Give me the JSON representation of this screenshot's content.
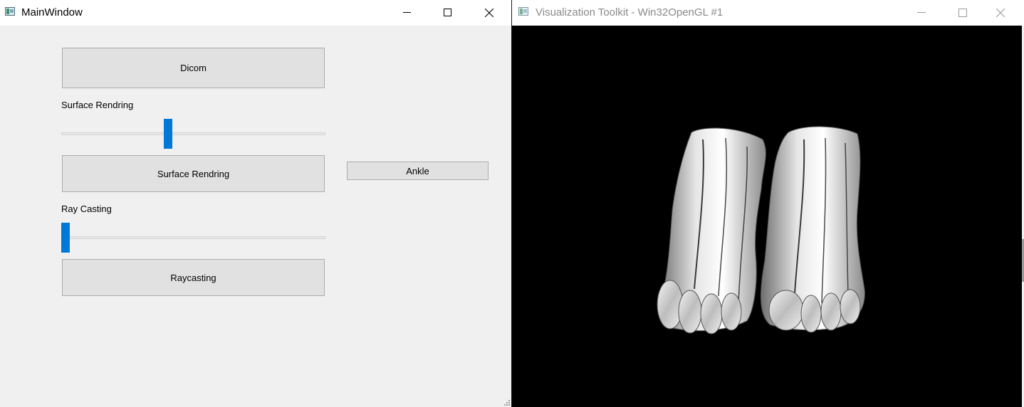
{
  "main_window": {
    "title": "MainWindow",
    "dicom_button": "Dicom",
    "surface_label": "Surface Rendring",
    "surface_slider_value": 0.4,
    "surface_button": "Surface Rendring",
    "ankle_button": "Ankle",
    "ray_label": "Ray Casting",
    "ray_slider_value": 0.0,
    "raycasting_button": "Raycasting"
  },
  "vtk_window": {
    "title": "Visualization Toolkit - Win32OpenGL #1",
    "render_content": "3D surface rendering of feet (ankle dataset)"
  },
  "colors": {
    "titlebar": "#ffffff",
    "client_bg": "#f0f0f0",
    "button_bg": "#e1e1e1",
    "button_border": "#adadad",
    "slider_handle": "#0078d7",
    "render_bg": "#000000"
  },
  "icons": [
    "app-icon",
    "minimize-icon",
    "maximize-icon",
    "close-icon"
  ]
}
